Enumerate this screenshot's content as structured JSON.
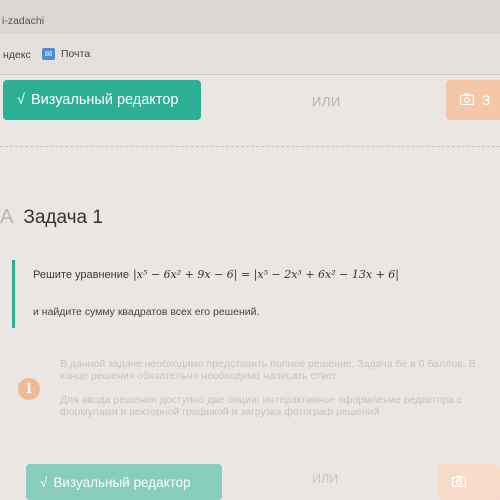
{
  "browser": {
    "tab_title": "i-zadachi",
    "bookmarks": [
      "ндекс",
      "Почта"
    ]
  },
  "editor_bar": {
    "visual_editor_label": "Визуальный редактор",
    "or_label": "ИЛИ",
    "photo_label": "З"
  },
  "task": {
    "title": "Задача 1",
    "prefix_mark": "A",
    "line1_text": "Решите уравнение",
    "formula": "|x⁵ − 6x² + 9x − 6| = |x⁵ − 2x³ + 6x² − 13x + 6|",
    "line2_text": "и найдите сумму квадратов всех его решений."
  },
  "info": {
    "paragraph1": "В данной задаче необходимо представить полное решение. Задача бе в 0 баллов. В конце решения обязательно необходимо написать ответ",
    "paragraph2": "Для ввода решения доступно две опции: интерактивное оформление редактора с формулами и векторной графикой и загрузка фотограф решений"
  },
  "bottom_bar": {
    "visual_editor_label": "Визуальный редактор",
    "or_label": "ИЛИ"
  },
  "colors": {
    "accent": "#2daf96",
    "photo": "#f3c7a8",
    "info_icon": "#f2b896"
  },
  "icons": [
    "camera-icon",
    "info-icon",
    "checkmark-icon",
    "mail-icon"
  ]
}
